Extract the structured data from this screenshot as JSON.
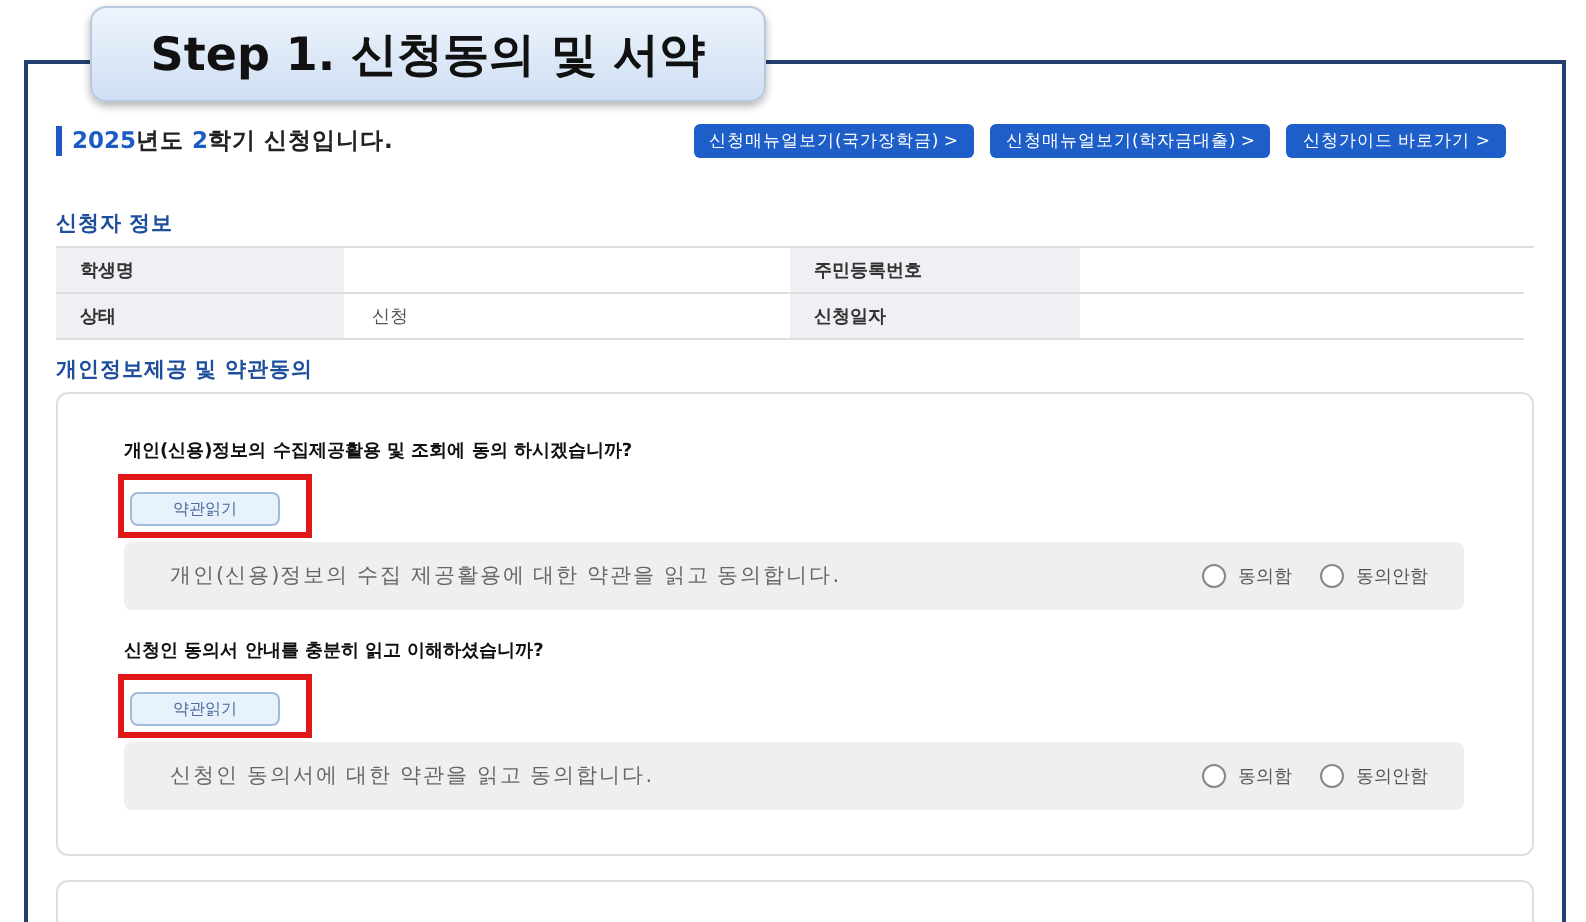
{
  "step_title": "Step 1. 신청동의 및 서약",
  "heading": {
    "year": "2025",
    "year_suffix": "년도 ",
    "term": "2",
    "rest": "학기 신청입니다."
  },
  "link_buttons": [
    "신청매뉴얼보기(국가장학금)  >",
    "신청매뉴얼보기(학자금대출)  >",
    "신청가이드 바로가기  >"
  ],
  "applicant_section": {
    "title": "신청자 정보",
    "rows": [
      {
        "label_1": "학생명",
        "label_2": "주민등록번호"
      },
      {
        "label_1": "상태",
        "value_1": "신청",
        "label_2": "신청일자"
      }
    ]
  },
  "consent_section": {
    "title": "개인정보제공 및 약관동의",
    "items": [
      {
        "question": "개인(신용)정보의 수집제공활용 및 조회에 동의 하시겠습니까?",
        "read_button": "약관읽기",
        "highlighted": true,
        "statement": "개인(신용)정보의 수집 제공활용에 대한 약관을 읽고 동의합니다.",
        "options": [
          {
            "label": "동의함",
            "selected": false
          },
          {
            "label": "동의안함",
            "selected": false
          }
        ]
      },
      {
        "question": "신청인 동의서 안내를 충분히 읽고 이해하셨습니까?",
        "read_button": "약관읽기",
        "highlighted": true,
        "statement": "신청인 동의서에 대한 약관을 읽고 동의합니다.",
        "options": [
          {
            "label": "동의함",
            "selected": false
          },
          {
            "label": "동의안함",
            "selected": false
          }
        ]
      }
    ]
  }
}
